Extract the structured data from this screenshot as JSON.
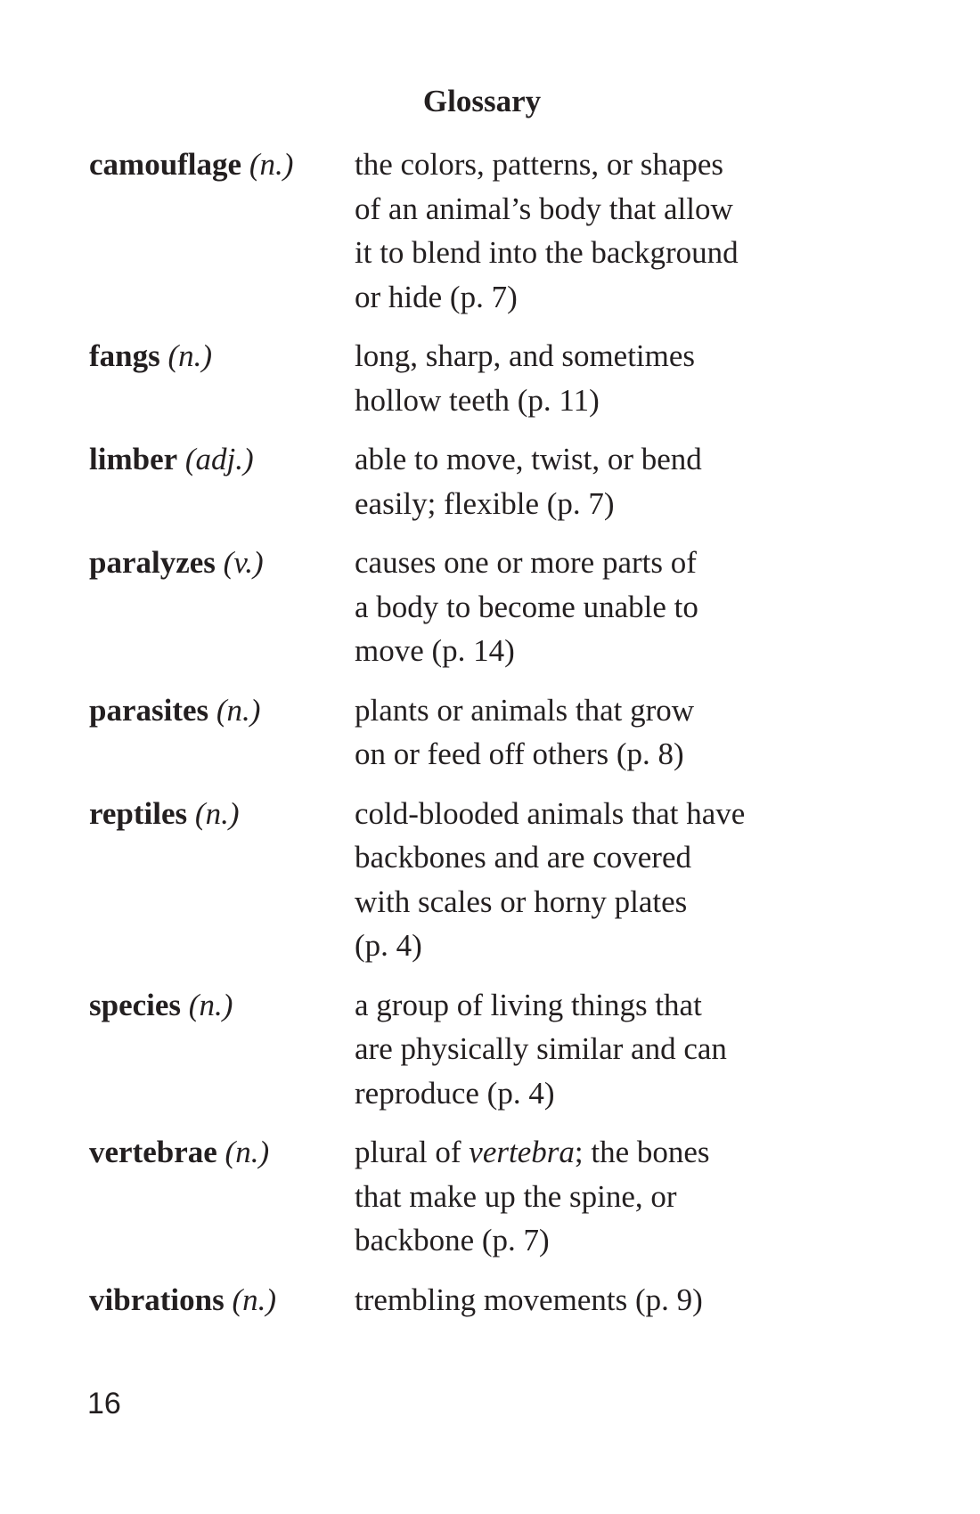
{
  "title": "Glossary",
  "page_number": "16",
  "entries": [
    {
      "term": "camouflage",
      "pos": "(n.)",
      "lines": [
        "the colors, patterns, or shapes",
        "of an animal’s body that allow",
        "it to blend into the background",
        "or hide (p. 7)"
      ]
    },
    {
      "term": "fangs",
      "pos": "(n.)",
      "lines": [
        "long, sharp, and sometimes",
        "hollow teeth (p. 11)"
      ]
    },
    {
      "term": "limber",
      "pos": "(adj.)",
      "lines": [
        "able to move, twist, or bend",
        "easily; flexible (p. 7)"
      ]
    },
    {
      "term": "paralyzes",
      "pos": "(v.)",
      "lines": [
        "causes one or more parts of",
        "a body to become unable to",
        "move (p. 14)"
      ]
    },
    {
      "term": "parasites",
      "pos": "(n.)",
      "lines": [
        "plants or animals that grow",
        "on or feed off others (p. 8)"
      ]
    },
    {
      "term": "reptiles",
      "pos": "(n.)",
      "lines": [
        "cold-blooded animals that have",
        "backbones and are covered",
        "with scales or horny plates",
        "(p. 4)"
      ]
    },
    {
      "term": "species",
      "pos": "(n.)",
      "lines": [
        "a group of living things that",
        "are physically similar and can",
        "reproduce (p. 4)"
      ]
    },
    {
      "term": "vertebrae",
      "pos": "(n.)",
      "line1_prefix": "plural of ",
      "line1_italic": "vertebra",
      "line1_suffix": "; the bones",
      "lines": [
        "that make up the spine, or",
        "backbone (p. 7)"
      ]
    },
    {
      "term": "vibrations",
      "pos": "(n.)",
      "lines": [
        "trembling movements (p. 9)"
      ]
    }
  ]
}
